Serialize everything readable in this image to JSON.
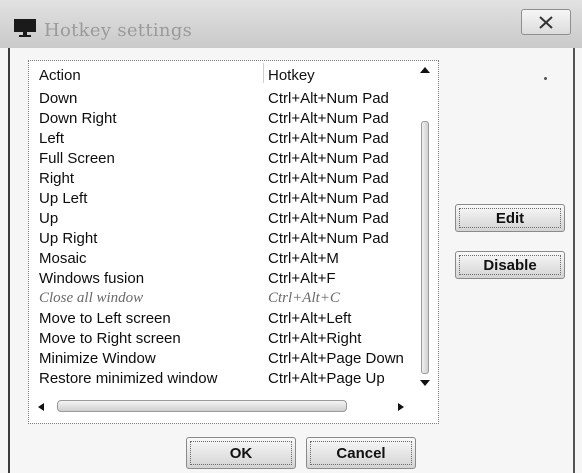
{
  "window": {
    "title": "Hotkey settings",
    "close_label": "✕"
  },
  "list": {
    "columns": {
      "action": "Action",
      "hotkey": "Hotkey"
    },
    "rows": [
      {
        "action": "Down",
        "hotkey": "Ctrl+Alt+Num Pad",
        "enabled": true
      },
      {
        "action": "Down Right",
        "hotkey": "Ctrl+Alt+Num Pad",
        "enabled": true
      },
      {
        "action": "Left",
        "hotkey": "Ctrl+Alt+Num Pad",
        "enabled": true
      },
      {
        "action": "Full Screen",
        "hotkey": "Ctrl+Alt+Num Pad",
        "enabled": true
      },
      {
        "action": "Right",
        "hotkey": "Ctrl+Alt+Num Pad",
        "enabled": true
      },
      {
        "action": "Up Left",
        "hotkey": "Ctrl+Alt+Num Pad",
        "enabled": true
      },
      {
        "action": "Up",
        "hotkey": "Ctrl+Alt+Num Pad",
        "enabled": true
      },
      {
        "action": "Up Right",
        "hotkey": "Ctrl+Alt+Num Pad",
        "enabled": true
      },
      {
        "action": "Mosaic",
        "hotkey": "Ctrl+Alt+M",
        "enabled": true
      },
      {
        "action": "Windows fusion",
        "hotkey": "Ctrl+Alt+F",
        "enabled": true
      },
      {
        "action": "Close all window",
        "hotkey": "Ctrl+Alt+C",
        "enabled": false
      },
      {
        "action": "Move to Left screen",
        "hotkey": "Ctrl+Alt+Left",
        "enabled": true
      },
      {
        "action": "Move to Right screen",
        "hotkey": "Ctrl+Alt+Right",
        "enabled": true
      },
      {
        "action": "Minimize Window",
        "hotkey": "Ctrl+Alt+Page Down",
        "enabled": true
      },
      {
        "action": "Restore minimized window",
        "hotkey": "Ctrl+Alt+Page Up",
        "enabled": true
      }
    ]
  },
  "buttons": {
    "edit": "Edit",
    "disable": "Disable",
    "ok": "OK",
    "cancel": "Cancel"
  },
  "icons": {
    "app": "monitor-icon",
    "close": "close-icon",
    "scroll_up": "arrow-up-icon",
    "scroll_down": "arrow-down-icon",
    "scroll_left": "arrow-left-icon",
    "scroll_right": "arrow-right-icon"
  },
  "colors": {
    "title_text": "#9a9a9a",
    "disabled_text": "#6a6a6a",
    "titlebar": "#d4d4d4"
  }
}
